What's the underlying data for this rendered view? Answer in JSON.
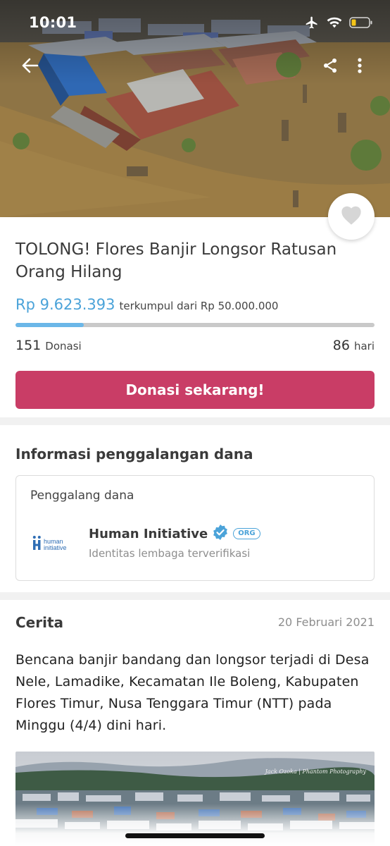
{
  "status_bar": {
    "time": "10:01",
    "battery_color": "#f5c518"
  },
  "campaign": {
    "title": "TOLONG! Flores Banjir Longsor Ratusan Orang Hilang",
    "raised": "Rp 9.623.393",
    "target_text": "terkumpul dari Rp 50.000.000",
    "progress_fraction": 0.19,
    "donations_count": "151",
    "donations_label": "Donasi",
    "days_count": "86",
    "days_label": "hari",
    "donate_button": "Donasi sekarang!"
  },
  "fundraiser_info": {
    "section_title": "Informasi penggalangan dana",
    "card_label": "Penggalang dana",
    "org_logo_text": "human initiative",
    "org_name": "Human Initiative",
    "org_badge": "ORG",
    "org_subtitle": "Identitas lembaga terverifikasi"
  },
  "story": {
    "title": "Cerita",
    "date": "20 Februari 2021",
    "body": "Bencana banjir bandang dan longsor terjadi di Desa Nele, Lamadike, Kecamatan Ile Boleng, Kabupaten Flores Timur, Nusa Tenggara Timur (NTT) pada Minggu (4/4) dini hari.",
    "image_watermark": "Jack Ozoka | Phantom Photography"
  },
  "colors": {
    "accent_blue": "#4ba3d9",
    "donate_button": "#c93d66",
    "progress_fill": "#6bb7e8"
  },
  "icons": [
    "airplane-icon",
    "wifi-icon",
    "battery-icon",
    "back-arrow-icon",
    "share-icon",
    "more-vertical-icon",
    "heart-icon",
    "verified-badge-icon"
  ]
}
